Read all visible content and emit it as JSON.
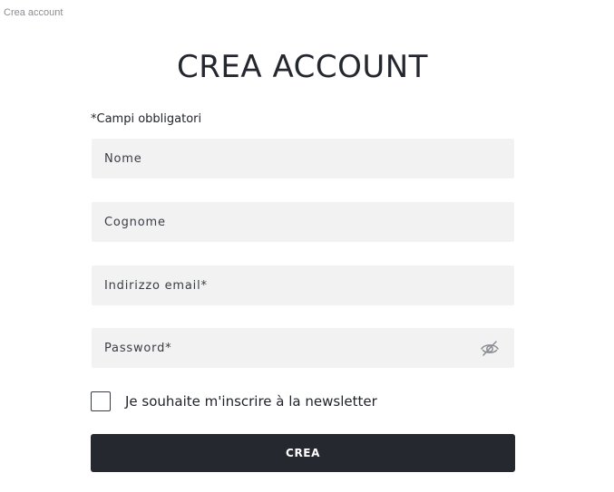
{
  "page": {
    "tab_caption": "Crea account",
    "title": "CREA ACCOUNT"
  },
  "form": {
    "required_note": "*Campi obbligatori",
    "fields": {
      "first_name": {
        "placeholder": "Nome",
        "value": ""
      },
      "last_name": {
        "placeholder": "Cognome",
        "value": ""
      },
      "email": {
        "placeholder": "Indirizzo email*",
        "value": ""
      },
      "password": {
        "placeholder": "Password*",
        "value": "",
        "toggle_icon": "eye-slash-icon"
      }
    },
    "newsletter": {
      "label": "Je souhaite m'inscrire à la newsletter",
      "checked": false
    },
    "submit_label": "CREA"
  },
  "colors": {
    "field_background": "#f2f2f3",
    "button_background": "#262830",
    "button_text": "#ffffff",
    "text": "#1f2229"
  }
}
